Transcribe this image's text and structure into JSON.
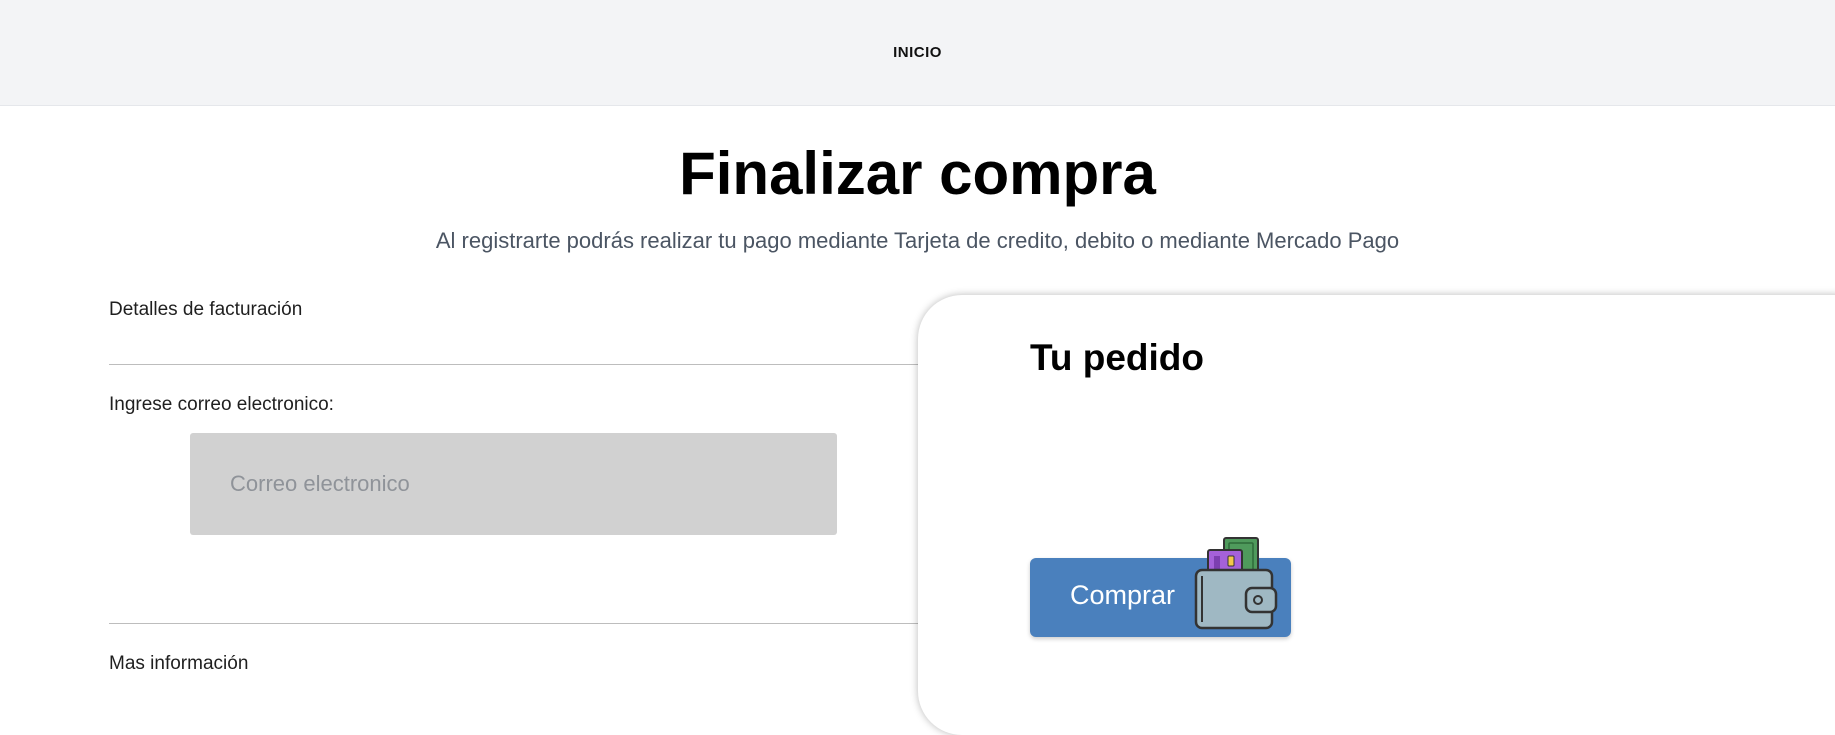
{
  "nav": {
    "home_label": "INICIO"
  },
  "header": {
    "title": "Finalizar compra",
    "subtitle": "Al registrarte podrás realizar tu pago mediante Tarjeta de credito, debito o mediante Mercado Pago"
  },
  "billing": {
    "section_label": "Detalles de facturación",
    "email_label": "Ingrese correo electronico:",
    "email_placeholder": "Correo electronico",
    "email_value": "",
    "more_info_label": "Mas información"
  },
  "order": {
    "title": "Tu pedido",
    "buy_label": "Comprar",
    "buy_icon": "wallet-icon"
  },
  "colors": {
    "topbar_bg": "#f3f4f6",
    "button_bg": "#4a80bd",
    "input_bg": "#d1d1d1"
  }
}
